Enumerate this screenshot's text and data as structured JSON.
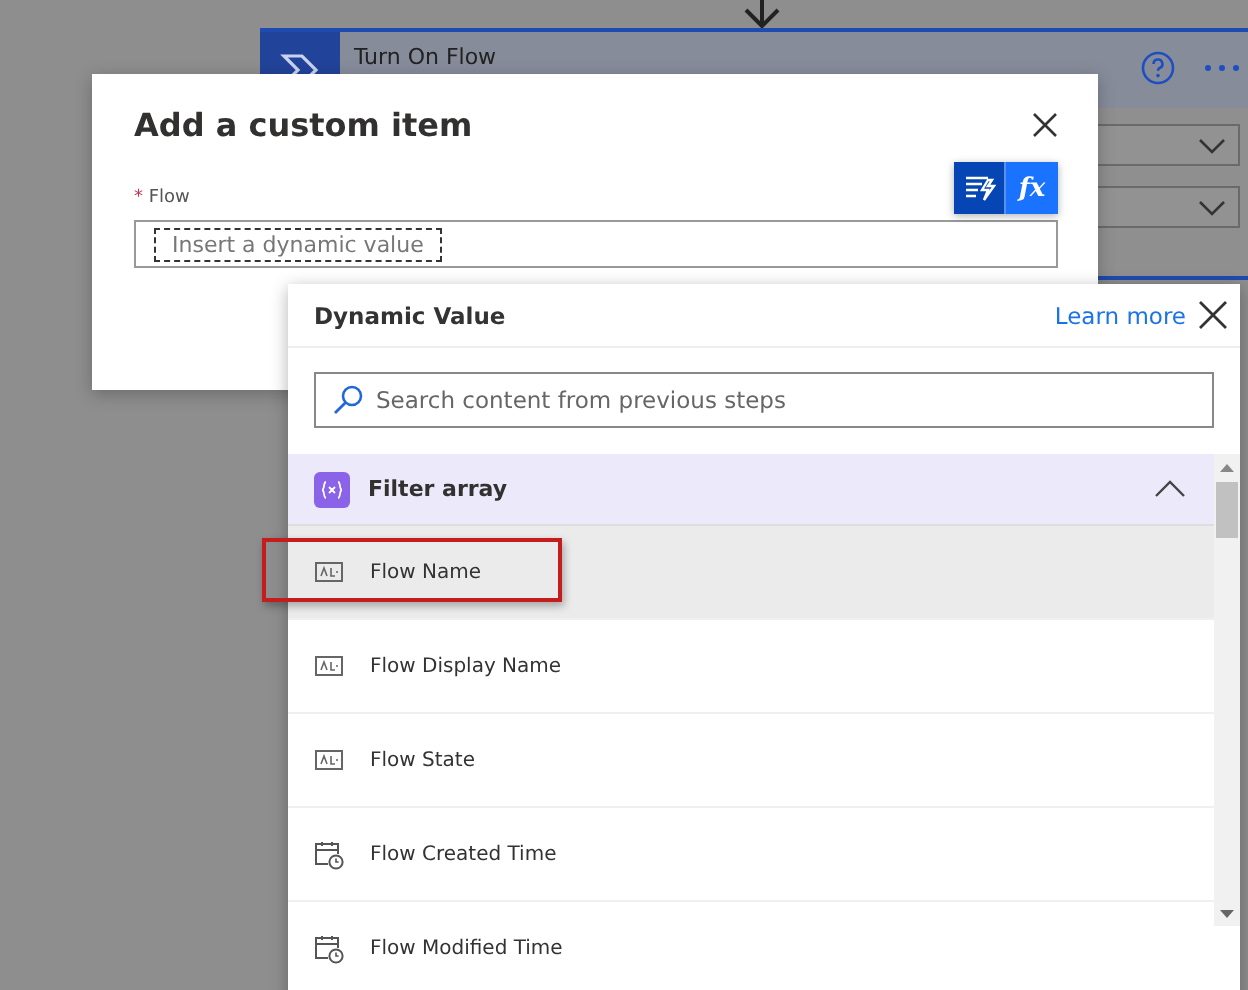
{
  "background_card": {
    "title": "Turn On Flow"
  },
  "dialog": {
    "title": "Add a custom item",
    "field": {
      "required_mark": "*",
      "label": "Flow",
      "placeholder": "Insert a dynamic value"
    },
    "modes": [
      {
        "kind": "dynamic",
        "selected": true
      },
      {
        "kind": "expression",
        "label": "fx",
        "selected": false
      }
    ]
  },
  "dynamic_panel": {
    "title": "Dynamic Value",
    "link": "Learn more",
    "search": {
      "placeholder": "Search content from previous steps"
    },
    "section": {
      "title": "Filter array",
      "expanded": true
    },
    "items": [
      {
        "kind": "text",
        "label": "Flow Name",
        "selected": true,
        "annotated": true
      },
      {
        "kind": "text",
        "label": "Flow Display Name",
        "selected": false,
        "annotated": false
      },
      {
        "kind": "text",
        "label": "Flow State",
        "selected": false,
        "annotated": false
      },
      {
        "kind": "datetime",
        "label": "Flow Created Time",
        "selected": false,
        "annotated": false
      },
      {
        "kind": "datetime",
        "label": "Flow Modified Time",
        "selected": false,
        "annotated": false
      }
    ]
  }
}
